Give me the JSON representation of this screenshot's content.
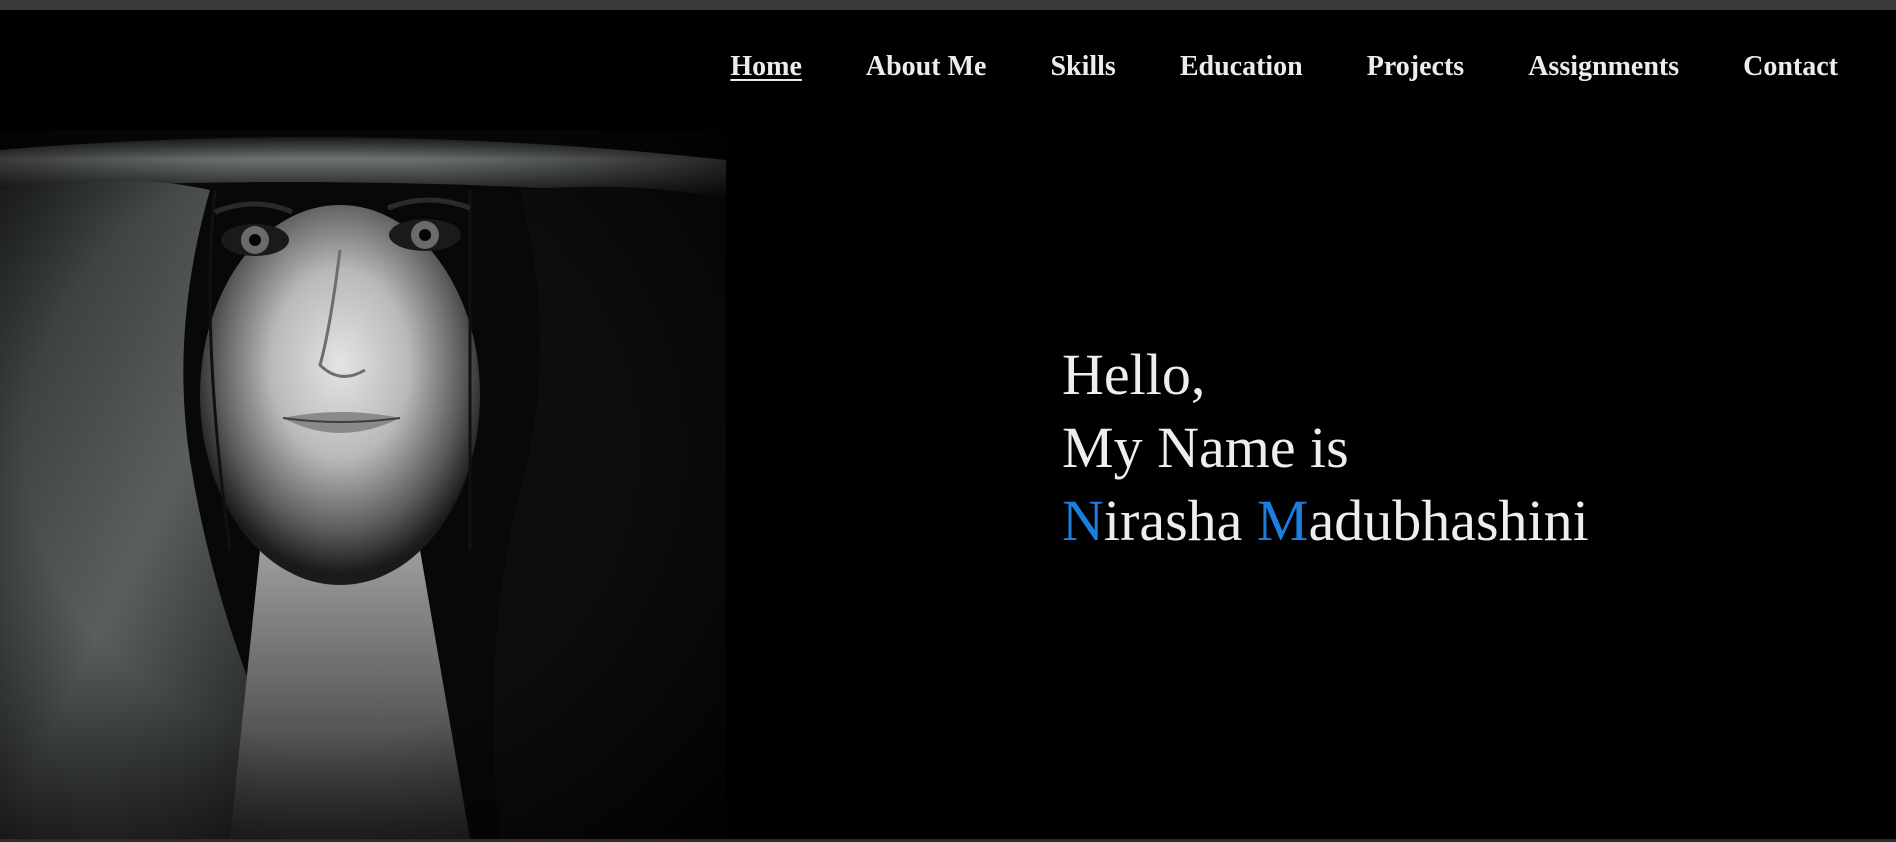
{
  "nav": {
    "items": [
      {
        "label": "Home",
        "active": true
      },
      {
        "label": "About Me",
        "active": false
      },
      {
        "label": "Skills",
        "active": false
      },
      {
        "label": "Education",
        "active": false
      },
      {
        "label": "Projects",
        "active": false
      },
      {
        "label": "Assignments",
        "active": false
      },
      {
        "label": "Contact",
        "active": false
      }
    ]
  },
  "hero": {
    "line1": "Hello,",
    "line2": "My Name is",
    "first_initial": "N",
    "first_rest": "irasha",
    "last_initial": "M",
    "last_rest": "adubhashini"
  },
  "colors": {
    "background": "#000000",
    "text": "#eeeeee",
    "accent": "#1a7fe0"
  },
  "icons": {
    "portrait": "hooded-woman-portrait-photo"
  }
}
